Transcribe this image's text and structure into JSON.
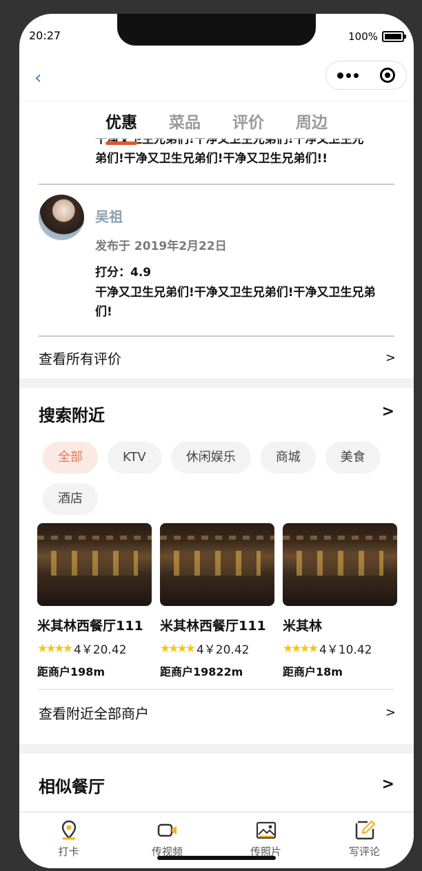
{
  "status_bar": {
    "time": "20:27",
    "battery": "100%"
  },
  "navbar": {
    "back_icon": "chevron-left-icon",
    "more_icon": "more-dots-icon",
    "close_icon": "target-icon"
  },
  "tabs": [
    {
      "label": "优惠",
      "active": true
    },
    {
      "label": "菜品",
      "active": false
    },
    {
      "label": "评价",
      "active": false
    },
    {
      "label": "周边",
      "active": false
    }
  ],
  "review_prev_clip": {
    "line1": "干净又卫生兄弟们!干净又卫生兄弟们!干净又卫生兄",
    "line2": "弟们!干净又卫生兄弟们!干净又卫生兄弟们!!"
  },
  "review": {
    "name": "吴祖",
    "date": "发布于 2019年2月22日",
    "score": "打分：4.9",
    "text": "干净又卫生兄弟们!干净又卫生兄弟们!干净又卫生兄弟们!"
  },
  "view_all_reviews": {
    "label": "查看所有评价",
    "arrow": ">"
  },
  "nearby": {
    "title": "搜索附近",
    "arrow": ">",
    "chips": [
      {
        "label": "全部",
        "active": true
      },
      {
        "label": "KTV",
        "active": false
      },
      {
        "label": "休闲娱乐",
        "active": false
      },
      {
        "label": "商城",
        "active": false
      },
      {
        "label": "美食",
        "active": false
      },
      {
        "label": "酒店",
        "active": false
      }
    ],
    "cards": [
      {
        "name": "米其林西餐厅111",
        "price": "4￥20.42",
        "distance": "距商户198m",
        "stars": "★★★★"
      },
      {
        "name": "米其林西餐厅111",
        "price": "4￥20.42",
        "distance": "距商户19822m",
        "stars": "★★★★"
      },
      {
        "name": "米其林",
        "price": "4￥10.42",
        "distance": "距商户18m",
        "stars": "★★★★"
      }
    ],
    "view_all": {
      "label": "查看附近全部商户",
      "arrow": ">"
    }
  },
  "similar": {
    "title": "相似餐厅",
    "arrow": ">"
  },
  "bottom_bar": [
    {
      "label": "打卡",
      "icon": "location-pin-icon"
    },
    {
      "label": "传视频",
      "icon": "video-camera-icon"
    },
    {
      "label": "传照片",
      "icon": "image-icon"
    },
    {
      "label": "写评论",
      "icon": "edit-icon"
    }
  ],
  "colors": {
    "accent": "#e0582a",
    "chip_active_bg": "#fbe9e3",
    "chip_active_text": "#e07a5a",
    "star": "#f5c518"
  }
}
